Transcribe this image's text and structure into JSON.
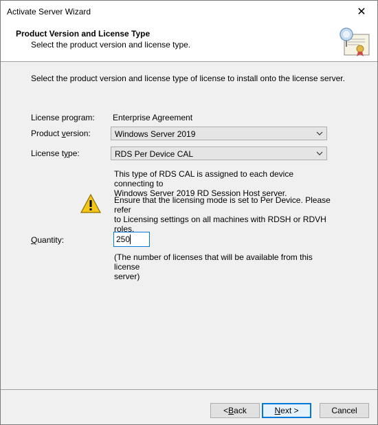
{
  "window": {
    "title": "Activate Server Wizard",
    "close_glyph": "✕"
  },
  "header": {
    "title": "Product Version and License Type",
    "subtitle": "Select the product version and license type.",
    "icon": "certificate-icon"
  },
  "main": {
    "intro": "Select the product version and license type of license to install onto the license server.",
    "license_program": {
      "label": "License program:",
      "value": "Enterprise Agreement"
    },
    "product_version": {
      "label_pre": "Product ",
      "label_ul": "v",
      "label_post": "ersion:",
      "selected": "Windows Server 2019"
    },
    "license_type": {
      "label_pre": "License t",
      "label_ul": "y",
      "label_post": "pe:",
      "selected": "RDS Per Device CAL"
    },
    "description_line1": "This type of RDS CAL is assigned to each device connecting to",
    "description_line2": "Windows Server 2019 RD Session Host server.",
    "warning_line1": "Ensure that the licensing mode is set to Per Device. Please refer",
    "warning_line2": "to Licensing settings on all machines with RDSH or RDVH roles.",
    "warning_icon": "warning-icon",
    "quantity": {
      "label_ul": "Q",
      "label_post": "uantity:",
      "value": "250",
      "hint_line1": "(The number of licenses that will be available from this license",
      "hint_line2": "server)"
    }
  },
  "footer": {
    "back": {
      "pre": "< ",
      "ul": "B",
      "post": "ack"
    },
    "next": {
      "ul": "N",
      "post": "ext >"
    },
    "cancel": "Cancel"
  },
  "colors": {
    "accent": "#0078d7",
    "dialog_bg": "#f0f0f0",
    "header_bg": "#ffffff"
  }
}
